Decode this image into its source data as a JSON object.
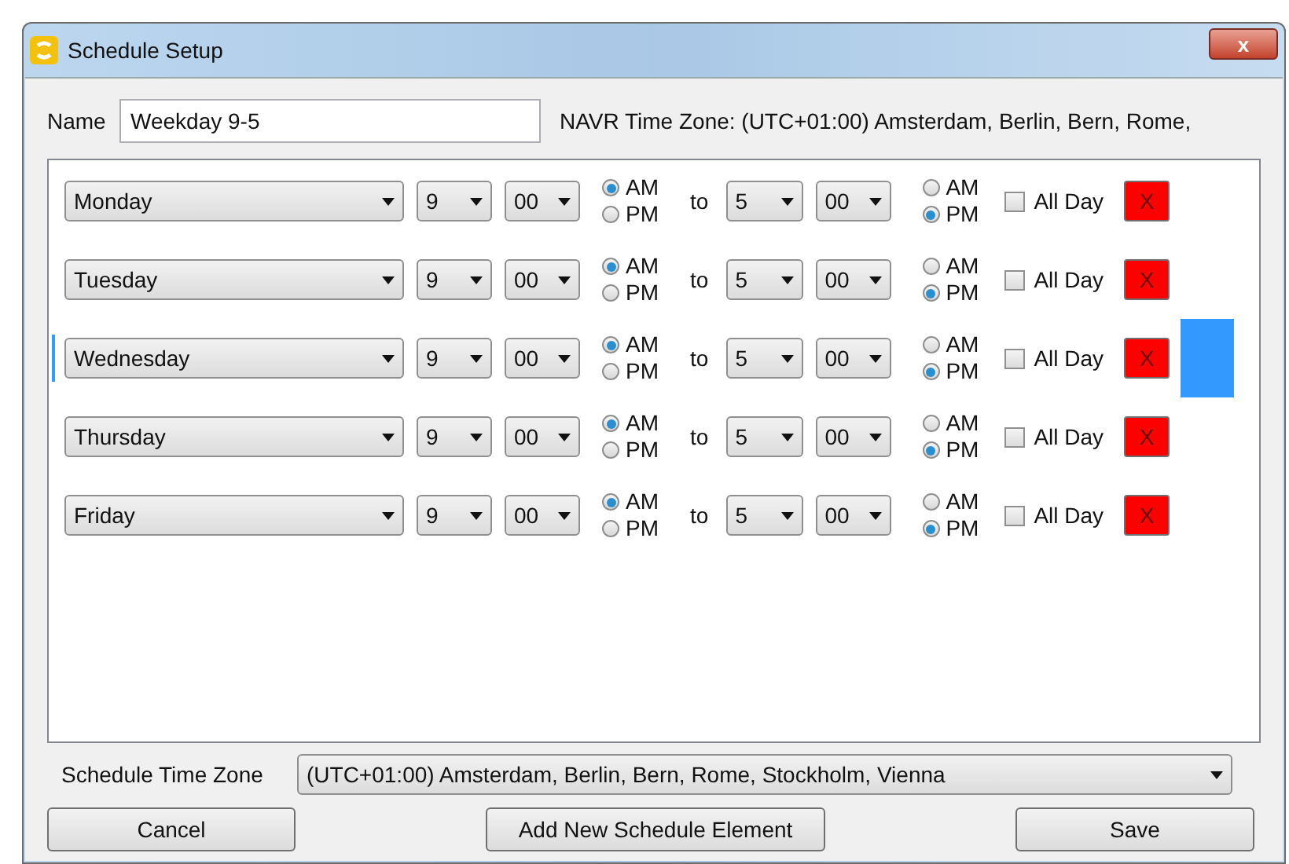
{
  "window": {
    "title": "Schedule Setup",
    "close_label": "x"
  },
  "name_label": "Name",
  "name_value": "Weekday 9-5",
  "navr_time_zone": "NAVR Time Zone: (UTC+01:00) Amsterdam, Berlin, Bern, Rome,",
  "rows": [
    {
      "day": "Monday",
      "start_hour": "9",
      "start_minute": "00",
      "start_period": [
        {
          "label": "AM",
          "selected": true
        },
        {
          "label": "PM",
          "selected": false
        }
      ],
      "to": "to",
      "end_hour": "5",
      "end_minute": "00",
      "end_period": [
        {
          "label": "AM",
          "selected": false
        },
        {
          "label": "PM",
          "selected": true
        }
      ],
      "all_day_label": "All Day",
      "all_day": false,
      "delete_label": "X",
      "selected": false
    },
    {
      "day": "Tuesday",
      "start_hour": "9",
      "start_minute": "00",
      "start_period": [
        {
          "label": "AM",
          "selected": true
        },
        {
          "label": "PM",
          "selected": false
        }
      ],
      "to": "to",
      "end_hour": "5",
      "end_minute": "00",
      "end_period": [
        {
          "label": "AM",
          "selected": false
        },
        {
          "label": "PM",
          "selected": true
        }
      ],
      "all_day_label": "All Day",
      "all_day": false,
      "delete_label": "X",
      "selected": false
    },
    {
      "day": "Wednesday",
      "start_hour": "9",
      "start_minute": "00",
      "start_period": [
        {
          "label": "AM",
          "selected": true
        },
        {
          "label": "PM",
          "selected": false
        }
      ],
      "to": "to",
      "end_hour": "5",
      "end_minute": "00",
      "end_period": [
        {
          "label": "AM",
          "selected": false
        },
        {
          "label": "PM",
          "selected": true
        }
      ],
      "all_day_label": "All Day",
      "all_day": false,
      "delete_label": "X",
      "selected": true
    },
    {
      "day": "Thursday",
      "start_hour": "9",
      "start_minute": "00",
      "start_period": [
        {
          "label": "AM",
          "selected": true
        },
        {
          "label": "PM",
          "selected": false
        }
      ],
      "to": "to",
      "end_hour": "5",
      "end_minute": "00",
      "end_period": [
        {
          "label": "AM",
          "selected": false
        },
        {
          "label": "PM",
          "selected": true
        }
      ],
      "all_day_label": "All Day",
      "all_day": false,
      "delete_label": "X",
      "selected": false
    },
    {
      "day": "Friday",
      "start_hour": "9",
      "start_minute": "00",
      "start_period": [
        {
          "label": "AM",
          "selected": true
        },
        {
          "label": "PM",
          "selected": false
        }
      ],
      "to": "to",
      "end_hour": "5",
      "end_minute": "00",
      "end_period": [
        {
          "label": "AM",
          "selected": false
        },
        {
          "label": "PM",
          "selected": true
        }
      ],
      "all_day_label": "All Day",
      "all_day": false,
      "delete_label": "X",
      "selected": false
    }
  ],
  "schedule_time_zone_label": "Schedule Time Zone",
  "schedule_time_zone": "(UTC+01:00) Amsterdam, Berlin, Bern, Rome, Stockholm, Vienna",
  "buttons": [
    "Cancel",
    "Add New Schedule Element",
    "Save"
  ]
}
